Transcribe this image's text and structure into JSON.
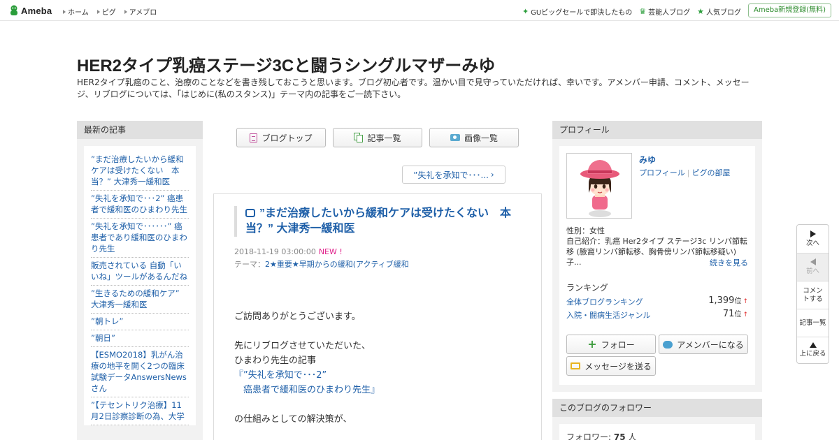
{
  "topbar": {
    "logo_text": "Ameba",
    "nav": [
      "ホーム",
      "ピグ",
      "アメブロ"
    ],
    "right_links": [
      "GUビッグセールで即決したもの",
      "芸能人ブログ",
      "人気ブログ"
    ],
    "signup_label": "Ameba新規登録(無料)"
  },
  "header": {
    "title": "HER2タイプ乳癌ステージ3Cと闘うシングルマザーみゆ",
    "description": "HER2タイプ乳癌のこと、治療のことなどを書き残しておこうと思います。ブログ初心者です。温かい目で見守っていただければ、幸いです。アメンバー申請、コメント、メッセージ、リブログについては、「はじめに(私のスタンス)」テーマ内の記事をご一読下さい。"
  },
  "left_sidebar": {
    "heading": "最新の記事",
    "items": [
      "”まだ治療したいから緩和ケアは受けたくない　本当？” 大津秀一緩和医",
      "”失礼を承知で･･･2” 癌患者で緩和医のひまわり先生",
      "”失礼を承知で･･････” 癌患者であり緩和医のひまわり先生",
      "販売されている 自動「いいね」ツールがあるんだね",
      "”生きるための緩和ケア” 大津秀一緩和医",
      "”朝トレ”",
      "”朝日”",
      "【ESMO2018】乳がん治療の地平を開く2つの臨床試験データAnswersNewsさん",
      "”【テセントリク治療】11月2日診察診断の為、大学"
    ]
  },
  "center": {
    "buttons": [
      "ブログトップ",
      "記事一覧",
      "画像一覧"
    ],
    "next_link": "”失礼を承知で･･･..."
  },
  "article": {
    "title": "”まだ治療したいから緩和ケアは受けたくない　本当？” 大津秀一緩和医",
    "date": "2018-11-19 03:00:00",
    "new_badge": "NEW !",
    "theme_label": "テーマ：",
    "theme": "2★重要★早期からの緩和(アクティブ緩和",
    "body": {
      "p1": "ご訪問ありがとうございます。",
      "p2a": "先にリブログさせていただいた、",
      "p2b": "ひまわり先生の記事",
      "link1": "『”失礼を承知で･･･2”",
      "link2": "　癌患者で緩和医のひまわり先生』",
      "p3": "の仕組みとしての解決策が、"
    }
  },
  "profile": {
    "heading": "プロフィール",
    "name": "みゆ",
    "link_profile": "プロフィール",
    "link_room": "ピグの部屋",
    "gender": "性別：女性",
    "intro": "自己紹介：乳癌 Her2タイプ ステージ3c リンパ節転移 (腋窩リンパ節転移、胸骨傍リンパ節転移疑い) 子...",
    "more": "続きを見る",
    "ranking_title": "ランキング",
    "rank_all_label": "全体ブログランキング",
    "rank_all_value": "1,399",
    "rank_genre_label": "入院・闘病生活ジャンル",
    "rank_genre_value": "71",
    "rank_unit": "位",
    "rank_arrow": "↑",
    "follow_label": "フォロー",
    "amember_label": "アメンバーになる",
    "message_label": "メッセージを送る"
  },
  "followers": {
    "heading": "このブログのフォロワー",
    "label": "フォロワー: ",
    "count": "75",
    "unit": " 人"
  },
  "floatnav": {
    "next": "次へ",
    "prev": "前へ",
    "comment": "コメントする",
    "list": "記事一覧",
    "top": "上に戻る"
  },
  "colors": {
    "link": "#1e5fa8",
    "accent_green": "#2a9d3a",
    "new_badge": "#e0208a"
  }
}
